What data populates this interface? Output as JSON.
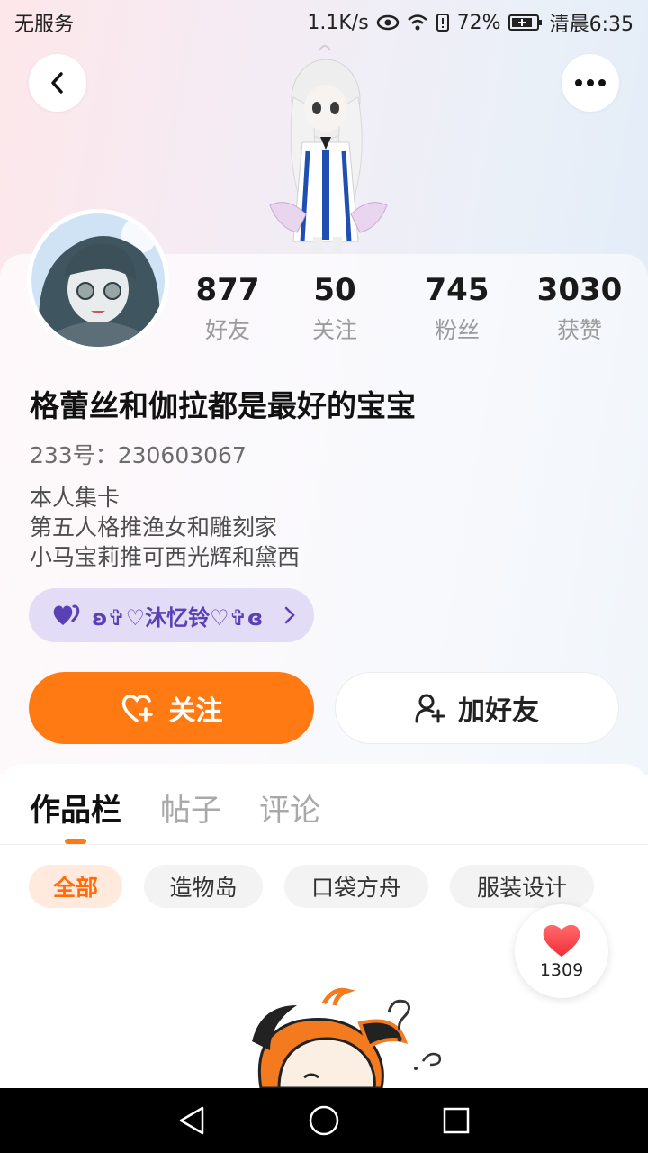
{
  "status_bar": {
    "carrier": "无服务",
    "net_speed": "1.1K/s",
    "battery": "72%",
    "time": "清晨6:35"
  },
  "profile": {
    "stats": [
      {
        "value": "877",
        "label": "好友"
      },
      {
        "value": "50",
        "label": "关注"
      },
      {
        "value": "745",
        "label": "粉丝"
      },
      {
        "value": "3030",
        "label": "获赞"
      }
    ],
    "username": "格蕾丝和伽拉都是最好的宝宝",
    "uid": "233号：230603067",
    "bio": [
      "本人集卡",
      "第五人格推渔女和雕刻家",
      "小马宝莉推可西光辉和黛西"
    ],
    "guild_name": "ʚ✞♡沐忆铃♡✞ɞ"
  },
  "actions": {
    "follow_label": "关注",
    "add_friend_label": "加好友"
  },
  "tabs": [
    "作品栏",
    "帖子",
    "评论"
  ],
  "filters": [
    "全部",
    "造物岛",
    "口袋方舟",
    "服装设计"
  ],
  "like_count": "1309",
  "colors": {
    "accent": "#ff7a12",
    "guild_bg": "#e2dcf6",
    "guild_text": "#5b3fb5"
  }
}
